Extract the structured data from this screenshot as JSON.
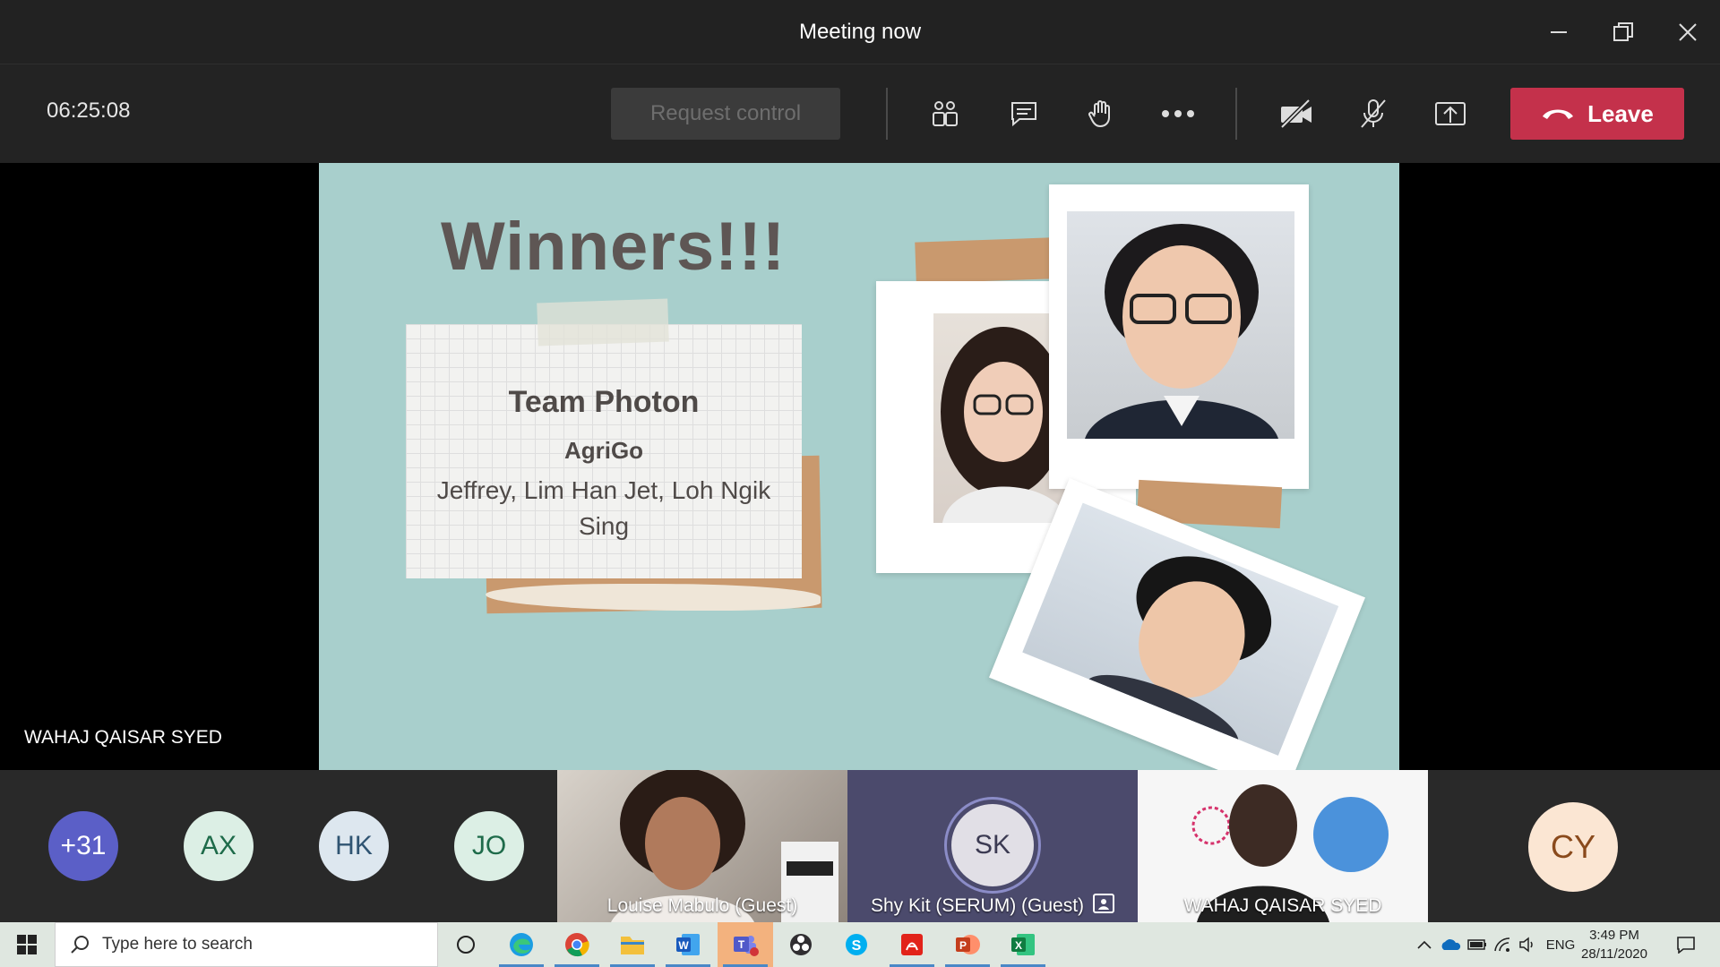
{
  "window": {
    "title": "Meeting now"
  },
  "toolbar": {
    "timer": "06:25:08",
    "request_control_label": "Request control",
    "leave_label": "Leave"
  },
  "slide": {
    "title": "Winners!!!",
    "team": "Team Photon",
    "app": "AgriGo",
    "members": "Jeffrey, Lim Han Jet, Loh Ngik Sing"
  },
  "stage": {
    "presenter_name": "WAHAJ QAISAR SYED"
  },
  "participants": {
    "avatars": [
      {
        "initials": "+31",
        "bg": "#5b5fc7",
        "fg": "#ffffff"
      },
      {
        "initials": "AX",
        "bg": "#dcefe5",
        "fg": "#1e6b4a"
      },
      {
        "initials": "HK",
        "bg": "#dde7ef",
        "fg": "#2f5472"
      },
      {
        "initials": "JO",
        "bg": "#dcefe5",
        "fg": "#1e6b4a"
      }
    ],
    "tiles": [
      {
        "name": "Louise Mabulo (Guest)"
      },
      {
        "name": "Shy Kit (SERUM) (Guest)",
        "initials": "SK"
      },
      {
        "name": "WAHAJ QAISAR SYED"
      }
    ],
    "last_avatar": {
      "initials": "CY",
      "bg": "#fbe6d3",
      "fg": "#8a4a1c"
    }
  },
  "taskbar": {
    "search_placeholder": "Type here to search",
    "language": "ENG",
    "time": "3:49 PM",
    "date": "28/11/2020"
  },
  "colors": {
    "leave": "#c4314b",
    "accent": "#5b5fc7",
    "slide_bg": "#a8cfcc"
  }
}
